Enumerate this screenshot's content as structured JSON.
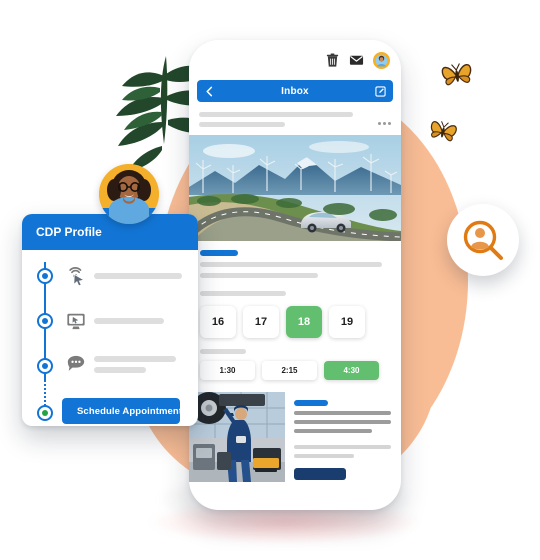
{
  "scene": {
    "title": "Automotive CDP and scheduling illustration",
    "colors": {
      "brand_blue": "#1275d5",
      "navy": "#1a3d70",
      "green": "#61bf6f",
      "green_dot": "#25a244",
      "peach": "#f9bd95",
      "orange": "#e07b14",
      "yellow": "#f5b02b",
      "placeholder_grey": "#dcdcdc"
    },
    "decor": {
      "leaves": "fern-leaves",
      "butterfly_1": "butterfly-icon",
      "butterfly_2": "butterfly-icon",
      "peach_circle": "background-circle",
      "pink_shadow": "drop-shadow"
    }
  },
  "phone": {
    "statusbar": {
      "trash_icon": "trash-icon",
      "mail_icon": "envelope-icon",
      "avatar": "user-avatar"
    },
    "appbar": {
      "back_icon": "chevron-left-icon",
      "title": "Inbox",
      "compose_icon": "compose-icon"
    },
    "mail_preview": {
      "subject_placeholder": "",
      "snippet_placeholder": "",
      "overflow_icon": "more-horizontal-icon"
    },
    "hero": {
      "alt": "white car driving on mountain road with wind turbines"
    },
    "booking": {
      "section_tag": "",
      "dates_label": "",
      "dates": [
        {
          "day": "16",
          "selected": false
        },
        {
          "day": "17",
          "selected": false
        },
        {
          "day": "18",
          "selected": true
        },
        {
          "day": "19",
          "selected": false
        }
      ],
      "times": [
        {
          "time": "1:30",
          "selected": false
        },
        {
          "time": "2:15",
          "selected": false
        },
        {
          "time": "4:30",
          "selected": true
        }
      ]
    },
    "service_card": {
      "photo_alt": "mechanic servicing a car in a garage",
      "cta_label": ""
    }
  },
  "cdp_card": {
    "header_title": "CDP Profile",
    "timeline": [
      {
        "icon": "click-cursor-icon",
        "lines": 1
      },
      {
        "icon": "monitor-cursor-icon",
        "lines": 1
      },
      {
        "icon": "chat-bubble-icon",
        "lines": 2
      }
    ],
    "cta": {
      "icon": "envelope-icon",
      "label": "Schedule Appointment"
    }
  },
  "badges": {
    "person_search": {
      "icon": "person-search-icon",
      "color": "#e07b14"
    },
    "woman_avatar": {
      "icon": "woman-avatar",
      "ring_color": "#f5b02b"
    }
  }
}
